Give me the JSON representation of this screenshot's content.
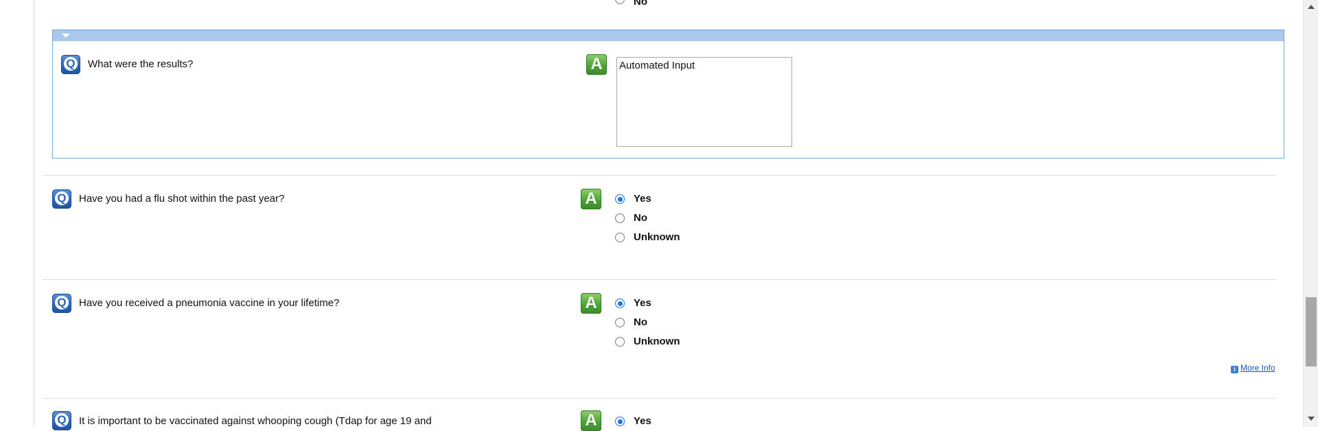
{
  "top_fragment": {
    "option_label": "No"
  },
  "subpanel": {
    "question": "What were the results?",
    "answer_text": "Automated Input"
  },
  "questions": [
    {
      "text": "Have you had a flu shot within the past year?",
      "options": [
        "Yes",
        "No",
        "Unknown"
      ],
      "selected": "Yes"
    },
    {
      "text": "Have you received a pneumonia vaccine in your lifetime?",
      "options": [
        "Yes",
        "No",
        "Unknown"
      ],
      "selected": "Yes",
      "more_info": "More Info"
    },
    {
      "text": "It is important to be vaccinated against whooping cough (Tdap for age 19 and",
      "options": [
        "Yes"
      ],
      "selected": "Yes"
    }
  ],
  "icons": {
    "question": "Q",
    "answer": "A",
    "info": "i"
  },
  "colors": {
    "accent": "#1a73e8",
    "subpanel_header": "#a9c8ec",
    "question_icon": "#2b64b8",
    "answer_icon": "#4fa537",
    "link": "#1a55b8"
  }
}
